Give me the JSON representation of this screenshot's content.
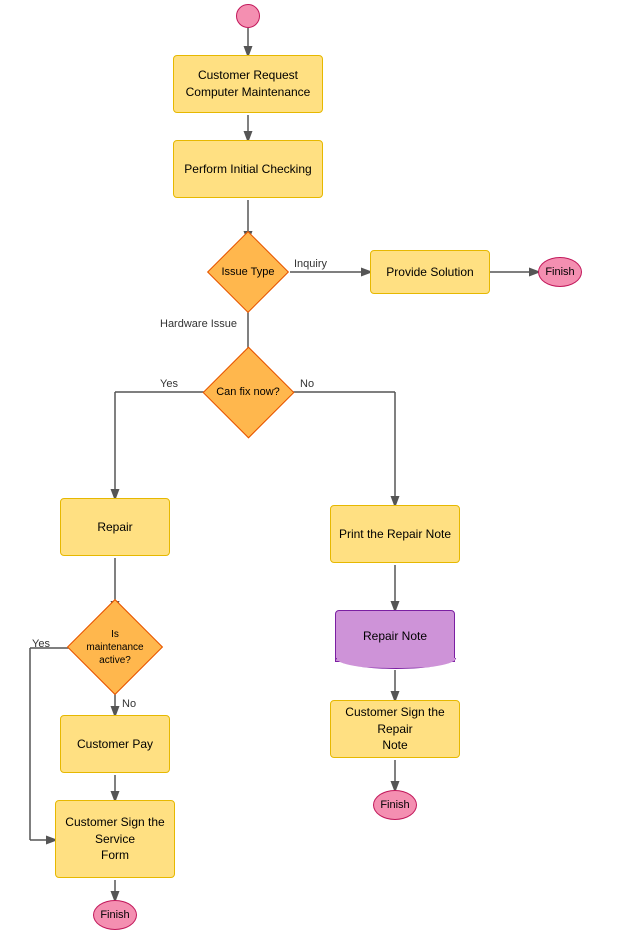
{
  "nodes": {
    "start": {
      "label": ""
    },
    "request": {
      "label": "Customer Request\nComputer Maintenance"
    },
    "initialCheck": {
      "label": "Perform Initial Checking"
    },
    "issueType": {
      "label": "Issue Type"
    },
    "provideSolution": {
      "label": "Provide Solution"
    },
    "finishTop": {
      "label": "Finish"
    },
    "canFixNow": {
      "label": "Can fix now?"
    },
    "repair": {
      "label": "Repair"
    },
    "printRepairNote": {
      "label": "Print the Repair Note"
    },
    "repairNote": {
      "label": "Repair Note"
    },
    "isMaintenance": {
      "label": "Is\nmaintenance\nactive?"
    },
    "customerPay": {
      "label": "Customer Pay"
    },
    "customerSignRepair": {
      "label": "Customer Sign the Repair\nNote"
    },
    "customerSignService": {
      "label": "Customer Sign the Service\nForm"
    },
    "finishRight": {
      "label": "Finish"
    },
    "finishBottom": {
      "label": "Finish"
    }
  },
  "labels": {
    "inquiry": "Inquiry",
    "hardwareIssue": "Hardware Issue",
    "yes1": "Yes",
    "no1": "No",
    "yes2": "Yes",
    "no2": "No"
  }
}
